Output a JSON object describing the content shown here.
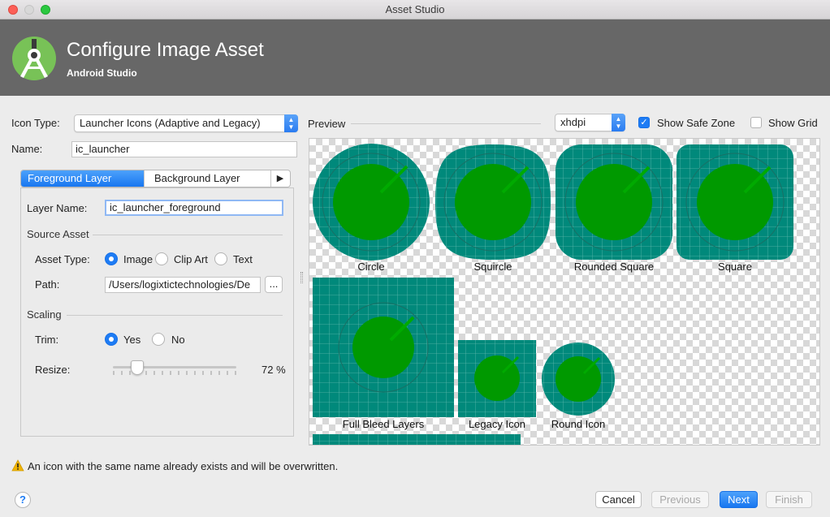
{
  "window": {
    "title": "Asset Studio"
  },
  "header": {
    "title": "Configure Image Asset",
    "subtitle": "Android Studio"
  },
  "form": {
    "icon_type_label": "Icon Type:",
    "icon_type_value": "Launcher Icons (Adaptive and Legacy)",
    "name_label": "Name:",
    "name_value": "ic_launcher"
  },
  "tabs": {
    "items": [
      {
        "label": "Foreground Layer",
        "selected": true
      },
      {
        "label": "Background Layer",
        "selected": false
      }
    ],
    "more_arrow": "▶"
  },
  "layer": {
    "layer_name_label": "Layer Name:",
    "layer_name_value": "ic_launcher_foreground",
    "source_asset_heading": "Source Asset",
    "asset_type_label": "Asset Type:",
    "asset_type_options": [
      "Image",
      "Clip Art",
      "Text"
    ],
    "asset_type_selected": "Image",
    "path_label": "Path:",
    "path_value": "/Users/logixtictechnologies/De",
    "browse_label": "...",
    "scaling_heading": "Scaling",
    "trim_label": "Trim:",
    "trim_options": [
      "Yes",
      "No"
    ],
    "trim_selected": "Yes",
    "resize_label": "Resize:",
    "resize_value": "72 %",
    "resize_fraction": 0.17
  },
  "preview": {
    "label": "Preview",
    "density_value": "xhdpi",
    "show_safe_zone_label": "Show Safe Zone",
    "show_safe_zone_checked": true,
    "show_grid_label": "Show Grid",
    "show_grid_checked": false,
    "icons": [
      "Circle",
      "Squircle",
      "Rounded Square",
      "Square",
      "Full Bleed Layers",
      "Legacy Icon",
      "Round Icon"
    ]
  },
  "warning": {
    "text": "An icon with the same name already exists and will be overwritten."
  },
  "footer": {
    "help_label": "?",
    "cancel": "Cancel",
    "previous": "Previous",
    "next": "Next",
    "finish": "Finish"
  },
  "colors": {
    "icon_background": "#00897b",
    "icon_foreground": "#009900",
    "accent": "#1e7cf4",
    "header_bg": "#676767"
  }
}
